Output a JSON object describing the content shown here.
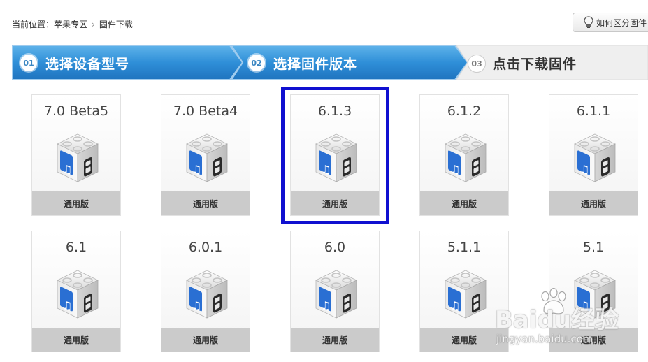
{
  "breadcrumb": {
    "prefix": "当前位置：",
    "items": [
      "苹果专区",
      "固件下载"
    ],
    "separator": "›"
  },
  "help_button": {
    "label": "如何区分固件"
  },
  "steps": [
    {
      "num": "01",
      "label": "选择设备型号",
      "state": "active"
    },
    {
      "num": "02",
      "label": "选择固件版本",
      "state": "active"
    },
    {
      "num": "03",
      "label": "点击下载固件",
      "state": "inactive"
    }
  ],
  "firmware": [
    {
      "version": "7.0 Beta5",
      "edition": "通用版"
    },
    {
      "version": "7.0 Beta4",
      "edition": "通用版"
    },
    {
      "version": "6.1.3",
      "edition": "通用版",
      "highlighted": true
    },
    {
      "version": "6.1.2",
      "edition": "通用版"
    },
    {
      "version": "6.1.1",
      "edition": "通用版"
    },
    {
      "version": "6.1",
      "edition": "通用版"
    },
    {
      "version": "6.0.1",
      "edition": "通用版"
    },
    {
      "version": "6.0",
      "edition": "通用版"
    },
    {
      "version": "5.1.1",
      "edition": "通用版"
    },
    {
      "version": "5.1",
      "edition": "通用版"
    }
  ],
  "watermark": {
    "brand": "Baidu经验",
    "url": "jingyan.baidu.com"
  },
  "colors": {
    "step_active": "#2f8fd8",
    "step_inactive": "#efefef",
    "highlight": "#1010d0",
    "edition_bar": "#cbcbcb"
  },
  "icons": [
    "lightbulb-icon",
    "itunes-firmware-cube-icon",
    "baidu-paw-icon"
  ]
}
